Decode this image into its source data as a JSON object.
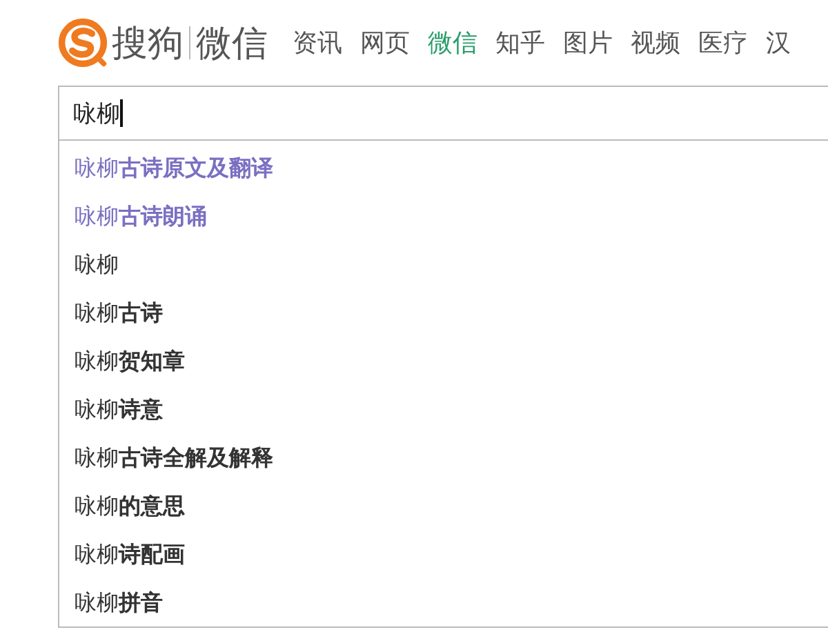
{
  "logo": {
    "brand": "搜狗",
    "product": "微信"
  },
  "tabs": [
    {
      "label": "资讯",
      "selected": false
    },
    {
      "label": "网页",
      "selected": false
    },
    {
      "label": "微信",
      "selected": true
    },
    {
      "label": "知乎",
      "selected": false
    },
    {
      "label": "图片",
      "selected": false
    },
    {
      "label": "视频",
      "selected": false
    },
    {
      "label": "医疗",
      "selected": false
    },
    {
      "label": "汉",
      "selected": false
    }
  ],
  "search": {
    "value": "咏柳"
  },
  "suggestions": [
    {
      "text": "咏柳**古诗原文及翻译**",
      "visited": true
    },
    {
      "text": "咏柳**古诗朗诵**",
      "visited": true
    },
    {
      "text": "咏柳",
      "visited": false
    },
    {
      "text": "咏柳**古诗**",
      "visited": false
    },
    {
      "text": "咏柳**贺知章**",
      "visited": false
    },
    {
      "text": "咏柳**诗意**",
      "visited": false
    },
    {
      "text": "咏柳**古诗全解及解释**",
      "visited": false
    },
    {
      "text": "咏柳**的意思**",
      "visited": false
    },
    {
      "text": "咏柳**诗配画**",
      "visited": false
    },
    {
      "text": "咏柳**拼音**",
      "visited": false
    }
  ]
}
